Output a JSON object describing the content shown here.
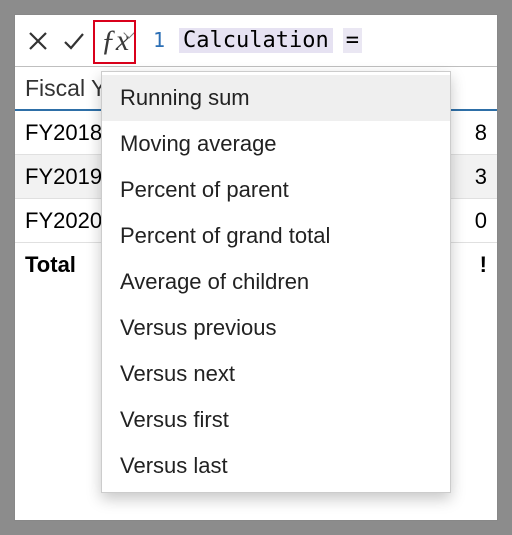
{
  "formula_bar": {
    "line_number": "1",
    "token": "Calculation",
    "eq": "="
  },
  "table": {
    "header": {
      "year": "Fiscal Ye…"
    },
    "rows": [
      {
        "year": "FY2018",
        "val": "8"
      },
      {
        "year": "FY2019",
        "val": "3"
      },
      {
        "year": "FY2020",
        "val": "0"
      }
    ],
    "total": {
      "label": "Total",
      "val": "!"
    }
  },
  "dropdown": {
    "items": [
      "Running sum",
      "Moving average",
      "Percent of parent",
      "Percent of grand total",
      "Average of children",
      "Versus previous",
      "Versus next",
      "Versus first",
      "Versus last"
    ]
  }
}
